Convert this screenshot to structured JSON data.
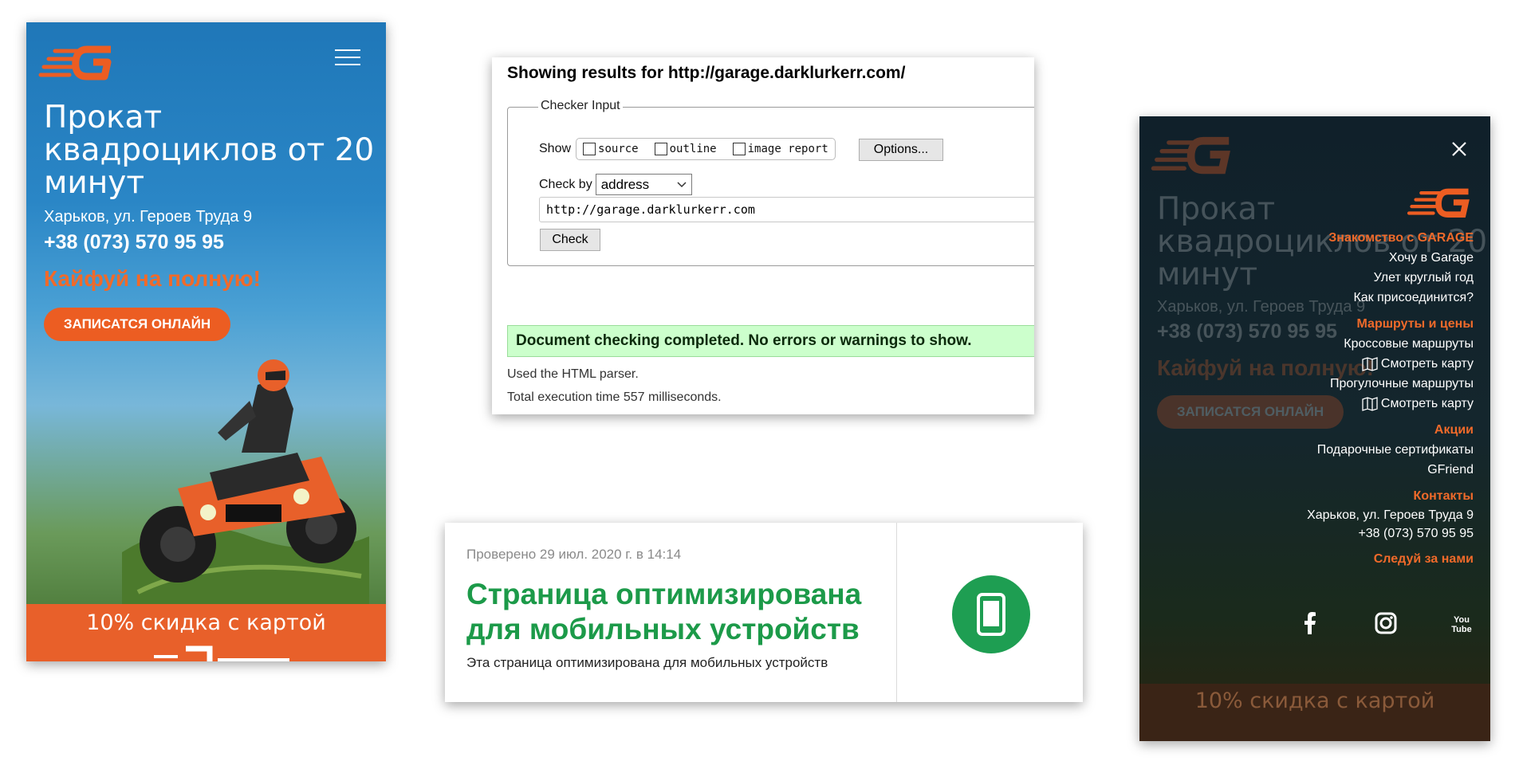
{
  "mobile_hero": {
    "title": "Прокат квадроциклов от 20 минут",
    "address": "Харьков, ул. Героев Труда 9",
    "phone": "+38 (073) 570 95 95",
    "slogan": "Кайфуй на полную!",
    "cta_label": "ЗАПИСАТСЯ ОНЛАЙН",
    "banner_text": "10% скидка с картой",
    "accent_color": "#ec5d22",
    "logo_icon": "garage-g-logo",
    "menu_icon": "hamburger-icon"
  },
  "checker": {
    "title": "Showing results for http://garage.darklurkerr.com/",
    "legend": "Checker Input",
    "show_label": "Show",
    "options": [
      "source",
      "outline",
      "image report"
    ],
    "options_button": "Options...",
    "check_by_label": "Check by",
    "check_by_value": "address",
    "url_value": "http://garage.darklurkerr.com",
    "check_button": "Check",
    "success_message": "Document checking completed. No errors or warnings to show.",
    "parser_note": "Used the HTML parser.",
    "execution_time": "Total execution time 557 milliseconds."
  },
  "mobile_test": {
    "checked_date": "Проверено 29 июл. 2020 г. в 14:14",
    "title": "Страница оптимизирована для мобильных устройств",
    "subtitle": "Эта страница оптимизирована для мобильных устройств",
    "accent_color": "#1c9a49",
    "icon": "mobile-phone-icon"
  },
  "menu_overlay": {
    "sections": [
      {
        "heading": "Знакомство с GARAGE",
        "links": [
          {
            "label": "Хочу в Garage"
          },
          {
            "label": "Улет круглый год"
          },
          {
            "label": "Как присоединится?"
          }
        ]
      },
      {
        "heading": "Маршруты и цены",
        "links": [
          {
            "label": "Кроссовые маршруты"
          },
          {
            "label": "Смотреть карту",
            "icon": "map-icon"
          },
          {
            "label": "Прогулочные маршруты"
          },
          {
            "label": "Смотреть карту",
            "icon": "map-icon"
          }
        ]
      },
      {
        "heading": "Акции",
        "links": [
          {
            "label": "Подарочные сертификаты"
          },
          {
            "label": "GFriend"
          }
        ]
      }
    ],
    "contacts_heading": "Контакты",
    "contact_address": "Харьков, ул. Героев Труда 9",
    "contact_phone": "+38 (073) 570 95 95",
    "follow_heading": "Следуй за нами",
    "social": [
      "facebook-icon",
      "instagram-icon",
      "youtube-icon"
    ],
    "youtube_text": "You Tube",
    "close_icon": "close-icon"
  }
}
